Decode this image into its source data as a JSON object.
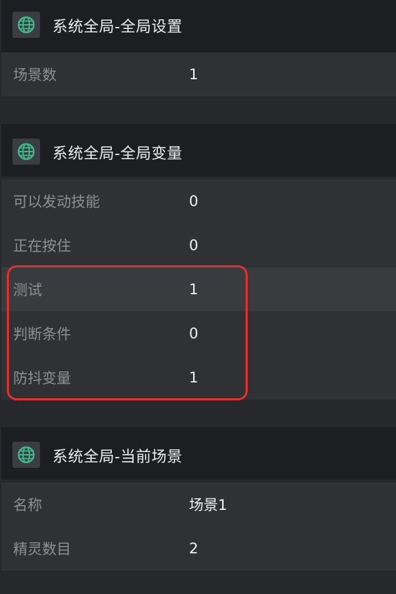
{
  "sections": [
    {
      "title": "系统全局-全局设置",
      "icon": "globe-icon",
      "rows": [
        {
          "label": "场景数",
          "value": "1"
        }
      ]
    },
    {
      "title": "系统全局-全局变量",
      "icon": "globe-icon",
      "rows": [
        {
          "label": "可以发动技能",
          "value": "0"
        },
        {
          "label": "正在按住",
          "value": "0"
        },
        {
          "label": "测试",
          "value": "1"
        },
        {
          "label": "判断条件",
          "value": "0"
        },
        {
          "label": "防抖变量",
          "value": "1"
        }
      ]
    },
    {
      "title": "系统全局-当前场景",
      "icon": "globe-icon",
      "rows": [
        {
          "label": "名称",
          "value": "场景1"
        },
        {
          "label": "精灵数目",
          "value": "2"
        }
      ]
    }
  ],
  "colors": {
    "background": "#27282c",
    "header_background": "#1d1e21",
    "row_background": "#303135",
    "row_highlight_background": "#3a3b3f",
    "label_text": "#8e8f95",
    "value_text": "#f0f0f2",
    "globe_icon": "#3fb88a",
    "annotation_border": "#e6302a"
  }
}
